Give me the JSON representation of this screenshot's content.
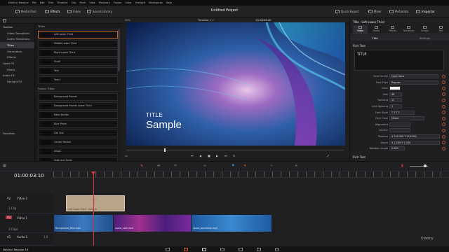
{
  "app": {
    "name": "DaVinci Resolve 19",
    "project_title": "Untitled Project"
  },
  "menu": [
    "DaVinci Resolve",
    "File",
    "Edit",
    "Trim",
    "Timeline",
    "Clip",
    "Mark",
    "View",
    "Playback",
    "Fusion",
    "Color",
    "Fairlight",
    "Workspace",
    "Help"
  ],
  "toolbar": {
    "media_pool": "Media Pool",
    "effects": "Effects",
    "index": "Index",
    "sound_library": "Sound Library",
    "quick_export": "Quick Export",
    "mixer": "Mixer",
    "metadata": "Metadata",
    "inspector": "Inspector"
  },
  "viewer_bar": {
    "zoom": "49%",
    "timeline_name": "Timeline 1",
    "source_timecode": "00:00:18:14",
    "current_timecode": "01:00:03:10"
  },
  "effects_tree": [
    {
      "label": "Toolbox",
      "sub": false,
      "selected": false
    },
    {
      "label": "Video Transitions",
      "sub": true,
      "selected": false
    },
    {
      "label": "Audio Transitions",
      "sub": true,
      "selected": false
    },
    {
      "label": "Titles",
      "sub": true,
      "selected": true
    },
    {
      "label": "Generators",
      "sub": true,
      "selected": false
    },
    {
      "label": "Effects",
      "sub": true,
      "selected": false
    },
    {
      "label": "Open FX",
      "sub": false,
      "selected": false
    },
    {
      "label": "Filters",
      "sub": true,
      "selected": false
    },
    {
      "label": "Audio FX",
      "sub": false,
      "selected": false
    },
    {
      "label": "Fairlight FX",
      "sub": true,
      "selected": false
    }
  ],
  "favorites_label": "Favorites",
  "titles_section": "Titles",
  "titles": [
    {
      "label": "Left Lower Third",
      "selected": true
    },
    {
      "label": "Middle Lower Third",
      "selected": false
    },
    {
      "label": "Right Lower Third",
      "selected": false
    },
    {
      "label": "Scroll",
      "selected": false
    },
    {
      "label": "Text",
      "selected": false
    },
    {
      "label": "Text+",
      "selected": false
    }
  ],
  "fusion_section": "Fusion Titles",
  "fusion_titles": [
    {
      "label": "Background Reveal"
    },
    {
      "label": "Background Reveal Lower Third"
    },
    {
      "label": "Basic Border"
    },
    {
      "label": "Blue Prism"
    },
    {
      "label": "Call Out"
    },
    {
      "label": "Center Reveal"
    },
    {
      "label": "Drops"
    },
    {
      "label": "Fade and Scale"
    }
  ],
  "overlay": {
    "title": "TITLE",
    "subtitle": "Sample"
  },
  "inspector": {
    "clip_name": "Title - Left Lower Third",
    "tabs": [
      "Video",
      "Audio",
      "Effects",
      "Transition",
      "Image",
      "File"
    ],
    "subtabs": [
      "Title",
      "Settings"
    ],
    "section_rich_text": "Rich Text",
    "rich_text_value": "TITLE",
    "section_rich_text_2": "Rich Text",
    "fields": [
      {
        "label": "Font Family",
        "value": "Open Sans"
      },
      {
        "label": "Font Face",
        "value": "Regular"
      },
      {
        "label": "Color",
        "value": ""
      },
      {
        "label": "Size",
        "value": "48"
      },
      {
        "label": "Tracking",
        "value": "11"
      },
      {
        "label": "Line Spacing",
        "value": "1"
      },
      {
        "label": "Font Style",
        "value": "T T T T"
      },
      {
        "label": "Font Case",
        "value": "Mixed"
      },
      {
        "label": "Alignment",
        "value": ""
      },
      {
        "label": "Anchor",
        "value": ""
      },
      {
        "label": "Position",
        "value": "X  192.000    Y  216.000"
      },
      {
        "label": "Zoom",
        "value": "X  1.000    Y  1.000"
      },
      {
        "label": "Rotation Angle",
        "value": "0.000"
      }
    ]
  },
  "timeline": {
    "timecode": "01:00:03:10",
    "tracks": [
      {
        "id": "V2",
        "name": "Video 2",
        "info": "1 Clip"
      },
      {
        "id": "V1",
        "name": "Video 1",
        "info": "3 Clips"
      },
      {
        "id": "A1",
        "name": "Audio 1",
        "info": "1.0"
      }
    ],
    "title_clip": "Left Lower Third - Sample",
    "video_clips": [
      {
        "label": "Background_Blue.mp4",
        "color": "#2a5a9e"
      },
      {
        "label": "space_swirl.mp4",
        "color": "#5a2a8e"
      },
      {
        "label": "space_wormhole.mp4",
        "color": "#2a6aa8"
      }
    ]
  },
  "colors": {
    "accent": "#e56a2a",
    "playhead": "#e03030",
    "title_clip": "#b9a48a"
  },
  "watermark": "Udemy"
}
